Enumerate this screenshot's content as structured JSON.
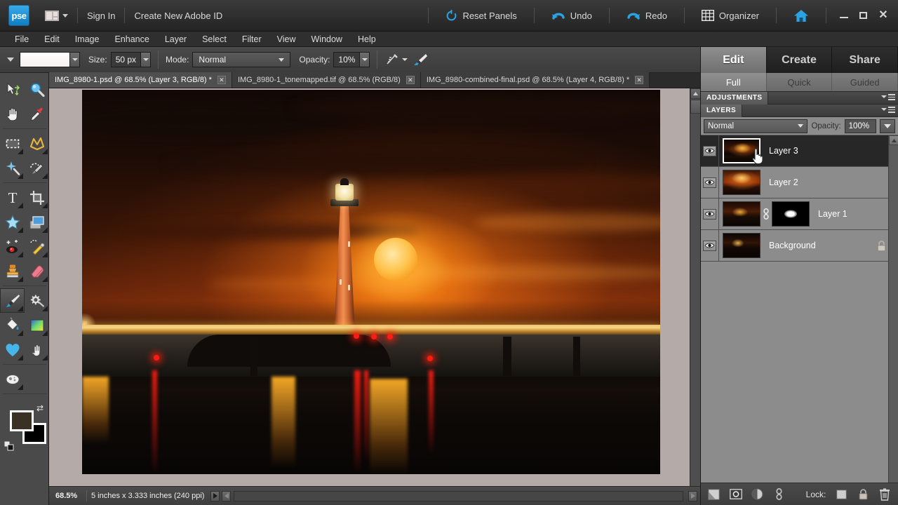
{
  "app": {
    "logo_text": "pse",
    "signin_label": "Sign In",
    "create_id_label": "Create New Adobe ID",
    "reset_panels_label": "Reset Panels",
    "undo_label": "Undo",
    "redo_label": "Redo",
    "organizer_label": "Organizer"
  },
  "menu": {
    "items": [
      {
        "label": "File"
      },
      {
        "label": "Edit"
      },
      {
        "label": "Image"
      },
      {
        "label": "Enhance"
      },
      {
        "label": "Layer"
      },
      {
        "label": "Select"
      },
      {
        "label": "Filter"
      },
      {
        "label": "View"
      },
      {
        "label": "Window"
      },
      {
        "label": "Help"
      }
    ]
  },
  "options_bar": {
    "size_label": "Size:",
    "size_value": "50 px",
    "mode_label": "Mode:",
    "mode_value": "Normal",
    "opacity_label": "Opacity:",
    "opacity_value": "10%"
  },
  "doc_tabs": [
    {
      "label": "IMG_8980-1.psd @ 68.5% (Layer 3, RGB/8) *",
      "active": true
    },
    {
      "label": "IMG_8980-1_tonemapped.tif @ 68.5% (RGB/8)",
      "active": false
    },
    {
      "label": "IMG_8980-combined-final.psd @ 68.5% (Layer 4, RGB/8) *",
      "active": false
    }
  ],
  "status_bar": {
    "zoom": "68.5%",
    "dimensions": "5 inches x 3.333 inches (240 ppi)"
  },
  "right_panel": {
    "mode_tabs": [
      {
        "label": "Edit",
        "active": true
      },
      {
        "label": "Create",
        "active": false
      },
      {
        "label": "Share",
        "active": false
      }
    ],
    "sub_tabs": [
      {
        "label": "Full",
        "active": true
      },
      {
        "label": "Quick",
        "active": false
      },
      {
        "label": "Guided",
        "active": false
      }
    ],
    "adjustments_title": "ADJUSTMENTS",
    "layers_title": "LAYERS",
    "blend_mode": "Normal",
    "opacity_label": "Opacity:",
    "opacity_value": "100%",
    "layers": [
      {
        "name": "Layer 3",
        "selected": true,
        "visible": true,
        "has_mask": false,
        "locked": false
      },
      {
        "name": "Layer 2",
        "selected": false,
        "visible": true,
        "has_mask": false,
        "locked": false
      },
      {
        "name": "Layer 1",
        "selected": false,
        "visible": true,
        "has_mask": true,
        "locked": false
      },
      {
        "name": "Background",
        "selected": false,
        "visible": true,
        "has_mask": false,
        "locked": true
      }
    ],
    "footer": {
      "lock_label": "Lock:"
    }
  },
  "toolbox": {
    "tools": [
      {
        "name": "move-tool",
        "row": 0
      },
      {
        "name": "zoom-tool",
        "row": 0
      },
      {
        "name": "hand-tool",
        "row": 1
      },
      {
        "name": "eyedropper-tool",
        "row": 1
      },
      {
        "name": "marquee-tool",
        "row": 2
      },
      {
        "name": "lasso-tool",
        "row": 2
      },
      {
        "name": "magic-wand-tool",
        "row": 3
      },
      {
        "name": "quick-selection-tool",
        "row": 3
      },
      {
        "name": "type-tool",
        "row": 4
      },
      {
        "name": "crop-tool",
        "row": 4
      },
      {
        "name": "cookie-cutter-tool",
        "row": 5
      },
      {
        "name": "straighten-tool",
        "row": 5
      },
      {
        "name": "red-eye-removal-tool",
        "row": 6
      },
      {
        "name": "healing-brush-tool",
        "row": 6
      },
      {
        "name": "clone-stamp-tool",
        "row": 7
      },
      {
        "name": "eraser-tool",
        "row": 7
      },
      {
        "name": "brush-tool",
        "row": 8,
        "selected": true
      },
      {
        "name": "smart-brush-tool",
        "row": 8
      },
      {
        "name": "paint-bucket-tool",
        "row": 9
      },
      {
        "name": "gradient-tool",
        "row": 9
      },
      {
        "name": "shape-tool",
        "row": 10
      },
      {
        "name": "blur-tool",
        "row": 10
      },
      {
        "name": "sponge-tool",
        "row": 11
      }
    ],
    "colors": {
      "foreground": "#3a3024",
      "background": "#000000"
    }
  },
  "colors": {
    "accent_blue": "#3aa9e8",
    "panel_bg": "#3b3b3b",
    "layers_bg": "#8c8c8c",
    "canvas_bg": "#b4aaa8"
  }
}
